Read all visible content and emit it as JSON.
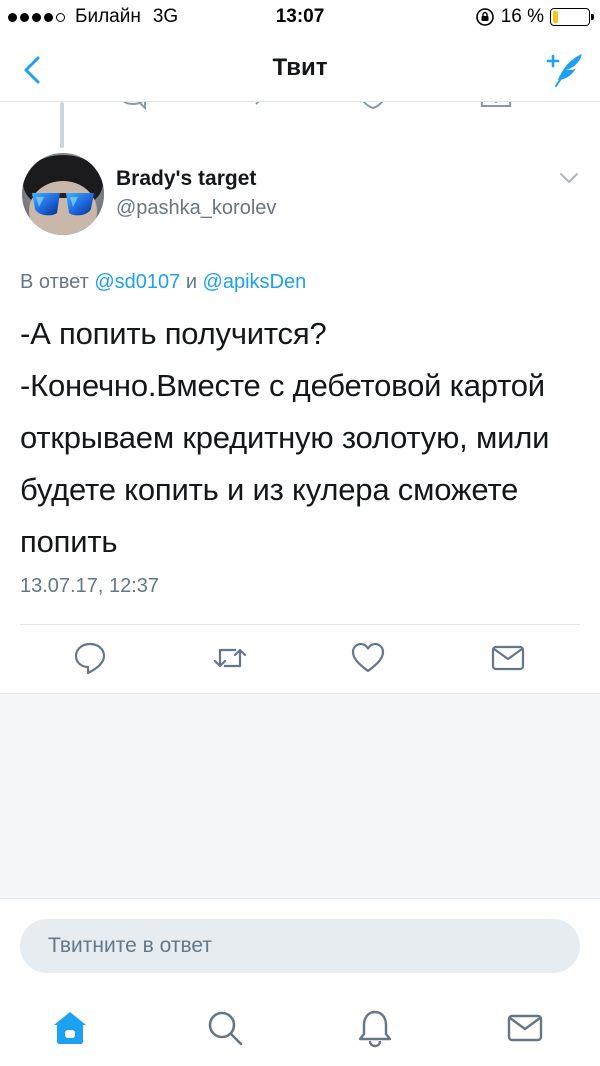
{
  "status_bar": {
    "carrier": "Билайн",
    "network": "3G",
    "time": "13:07",
    "battery": "16 %",
    "battery_level": 0.16
  },
  "nav": {
    "back_icon": "chevron-left-icon",
    "title": "Твит",
    "compose_icon": "compose-tweet-icon"
  },
  "tweet": {
    "author_name": "Brady's target",
    "author_handle": "@pashka_korolev",
    "reply_prefix": "В ответ",
    "reply_mention_1": "@sd0107",
    "reply_joiner": "и",
    "reply_mention_2": "@apiksDen",
    "text": "-А попить получится?\n-Конечно.Вместе с дебетовой картой открываем кредитную золотую, мили будете копить и из кулера сможете попить",
    "timestamp": "13.07.17, 12:37"
  },
  "actions": [
    "reply-icon",
    "retweet-icon",
    "like-icon",
    "direct-message-icon"
  ],
  "reply_bar": {
    "placeholder": "Твитните в ответ"
  },
  "tabs": [
    "home-icon",
    "search-icon",
    "notifications-icon",
    "messages-icon"
  ],
  "colors": {
    "accent": "#1da1f2",
    "icon_gray": "#657786",
    "battery_fill": "#f5c518"
  }
}
